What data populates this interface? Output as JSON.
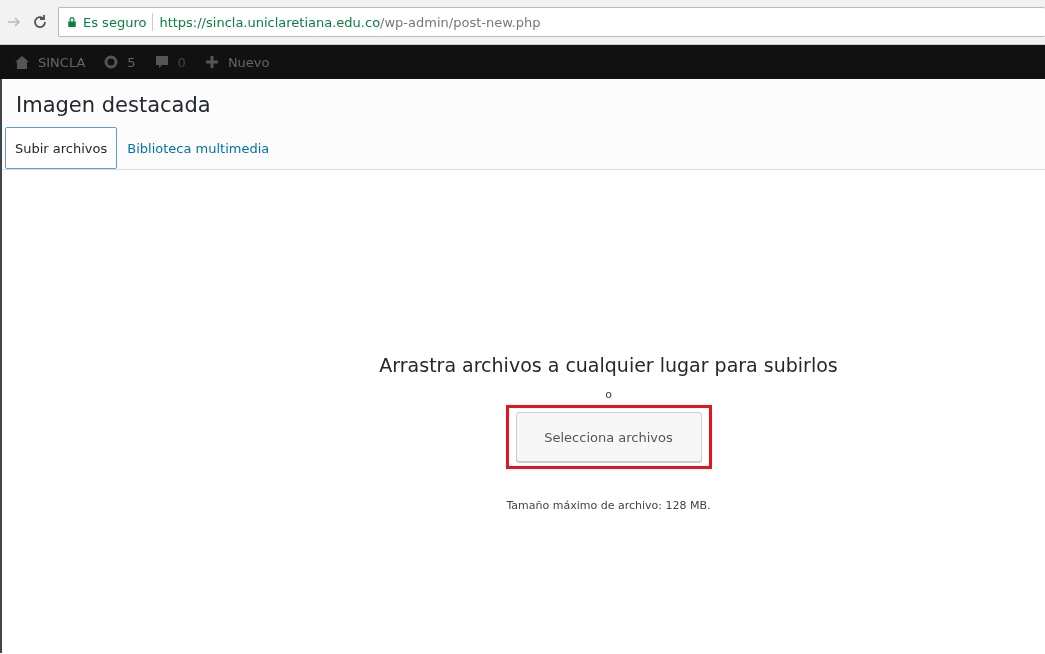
{
  "browser": {
    "secure_label": "Es seguro",
    "url_host": "https://sincla.uniclaretiana.edu.co",
    "url_path": "/wp-admin/post-new.php"
  },
  "admin_bar": {
    "site": "SINCLA",
    "updates": "5",
    "comments": "0",
    "new": "Nuevo"
  },
  "modal": {
    "title": "Imagen destacada",
    "tabs": [
      {
        "label": "Subir archivos",
        "selected": true
      },
      {
        "label": "Biblioteca multimedia",
        "selected": false
      }
    ],
    "drop_text": "Arrastra archivos a cualquier lugar para subirlos",
    "or": "o",
    "select_button": "Selecciona archivos",
    "highlighted": true,
    "max_size": "Tamaño máximo de archivo: 128 MB."
  }
}
